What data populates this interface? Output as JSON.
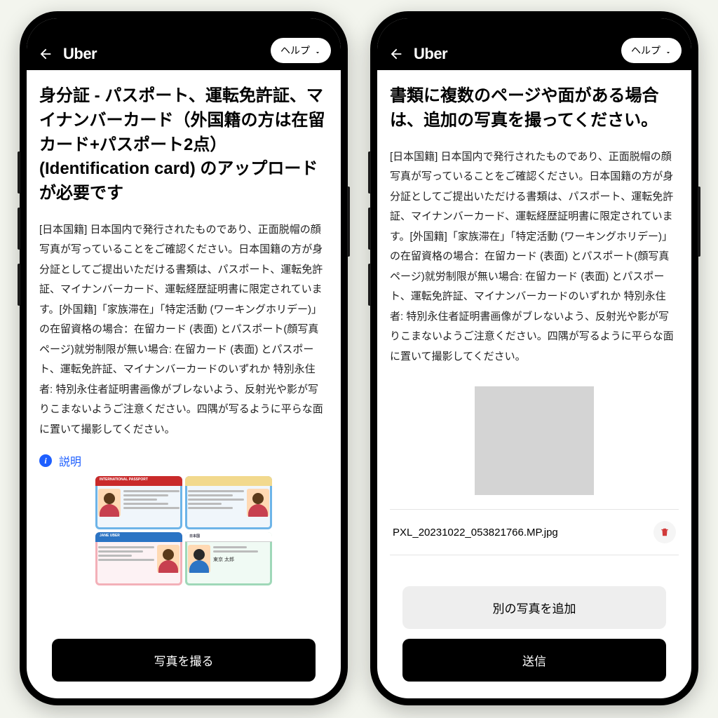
{
  "header": {
    "logo": "Uber",
    "help_label": "ヘルプ"
  },
  "phone1": {
    "title": "身分証 - パスポート、運転免許証、マイナンバーカード（外国籍の方は在留カード+パスポート2点）(Identification card) のアップロードが必要です",
    "body": "[日本国籍] 日本国内で発行されたものであり、正面脱帽の顔写真が写っていることをご確認ください。日本国籍の方が身分証としてご提出いただける書類は、パスポート、運転免許証、マイナンバーカード、運転経歴証明書に限定されています。[外国籍]「家族滞在」「特定活動 (ワーキングホリデー)」の在留資格の場合：在留カード (表面) とパスポート(顔写真ページ)就労制限が無い場合: 在留カード (表面) とパスポート、運転免許証、マイナンバーカードのいずれか 特別永住者: 特別永住者証明書画像がブレないよう、反射光や影が写りこまないようご注意ください。四隅が写るように平らな面に置いて撮影してください。",
    "info_label": "説明",
    "sample_cards": {
      "passport_header": "INTERNATIONAL PASSPORT",
      "license_name": "JANE UBER",
      "jp_name": "東京 太郎",
      "jp_header": "日本国"
    },
    "primary_button": "写真を撮る"
  },
  "phone2": {
    "title": "書類に複数のページや面がある場合は、追加の写真を撮ってください。",
    "body": "[日本国籍] 日本国内で発行されたものであり、正面脱帽の顔写真が写っていることをご確認ください。日本国籍の方が身分証としてご提出いただける書類は、パスポート、運転免許証、マイナンバーカード、運転経歴証明書に限定されています。[外国籍]「家族滞在」「特定活動 (ワーキングホリデー)」の在留資格の場合：在留カード (表面) とパスポート(顔写真ページ)就労制限が無い場合: 在留カード (表面) とパスポート、運転免許証、マイナンバーカードのいずれか 特別永住者: 特別永住者証明書画像がブレないよう、反射光や影が写りこまないようご注意ください。四隅が写るように平らな面に置いて撮影してください。",
    "filename": "PXL_20231022_053821766.MP.jpg",
    "secondary_button": "別の写真を追加",
    "primary_button": "送信"
  }
}
